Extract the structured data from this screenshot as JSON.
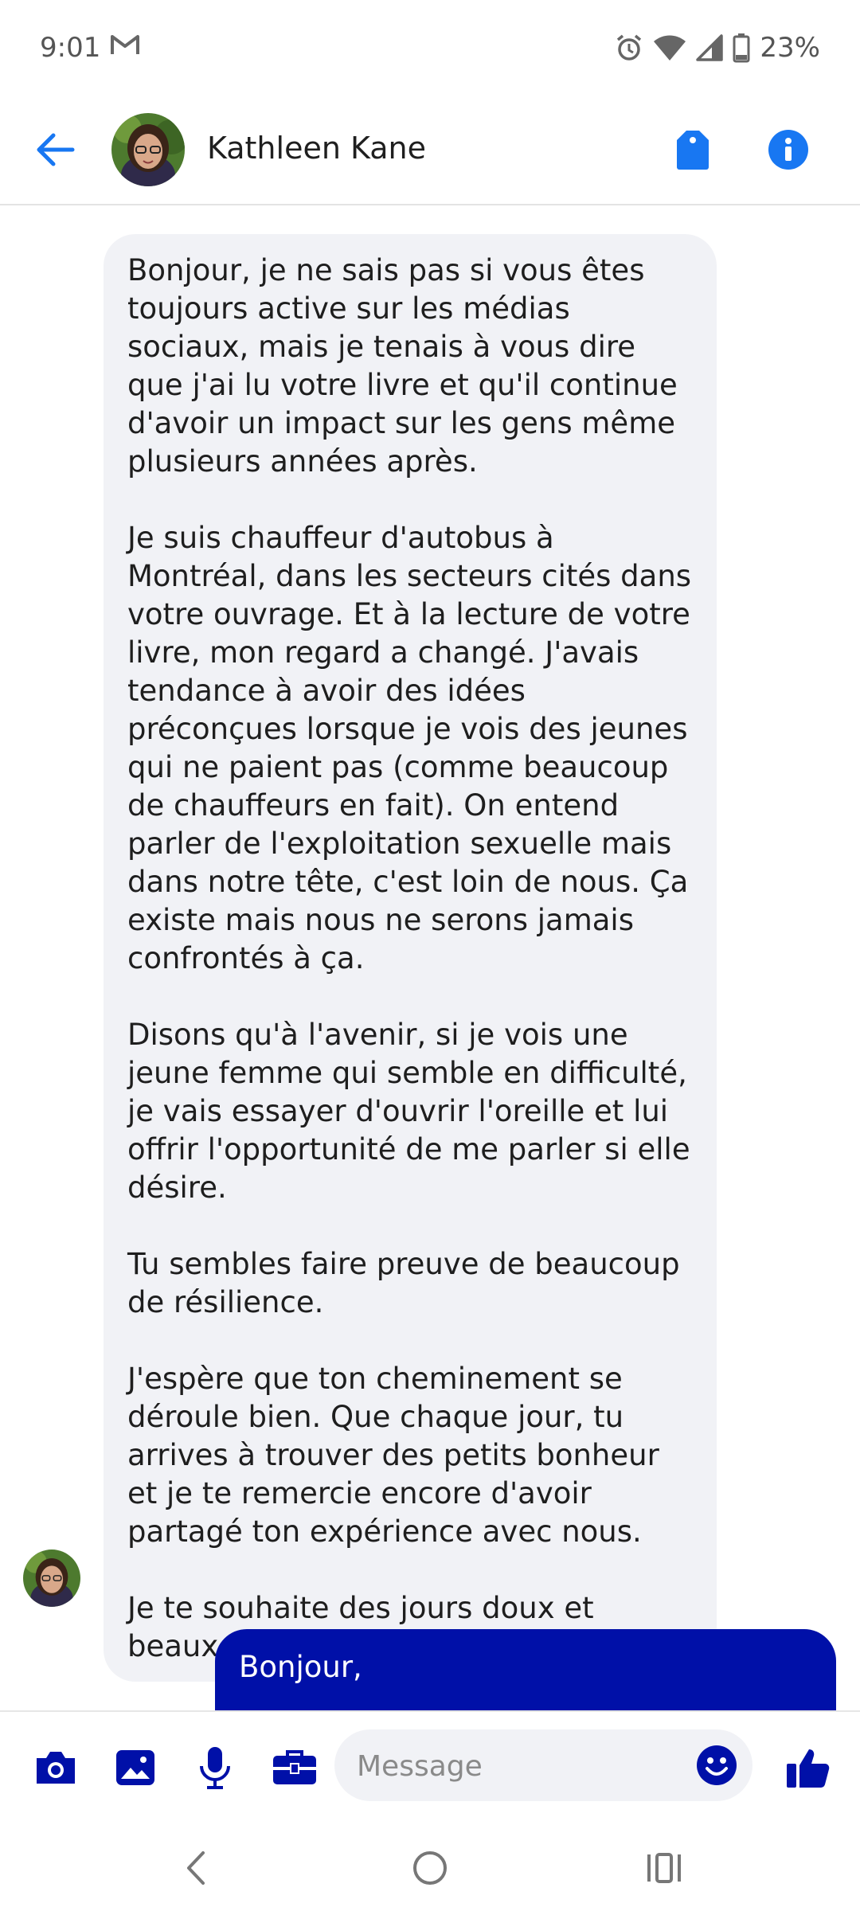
{
  "status_bar": {
    "time": "9:01",
    "battery": "23%",
    "icons": [
      "gmail-icon",
      "alarm-icon",
      "wifi-icon",
      "signal-icon",
      "battery-icon"
    ]
  },
  "header": {
    "contact_name": "Kathleen Kane",
    "icons": [
      "back-arrow-icon",
      "avatar",
      "tag-icon",
      "info-icon"
    ],
    "accent_color": "#1877f2"
  },
  "messages": [
    {
      "direction": "incoming",
      "paragraphs": [
        "Bonjour, je ne sais pas si vous êtes toujours active sur les médias sociaux, mais je tenais à vous dire que j'ai lu votre livre et qu'il continue d'avoir un impact sur les gens même plusieurs années après.",
        "Je suis chauffeur d'autobus à Montréal, dans les secteurs cités dans votre ouvrage. Et à la lecture de votre livre, mon regard a changé. J'avais tendance à avoir des idées préconçues lorsque je vois des jeunes qui ne paient pas (comme beaucoup de chauffeurs en fait). On entend parler de l'exploitation sexuelle mais dans notre tête, c'est loin de nous. Ça existe mais nous ne serons jamais confrontés à ça.",
        "Disons qu'à l'avenir, si je vois une jeune femme qui semble en difficulté, je vais essayer d'ouvrir l'oreille et lui offrir l'opportunité de me parler si elle désire.",
        "Tu sembles faire preuve de beaucoup de résilience.",
        "J'espère que ton cheminement se déroule bien. Que chaque jour, tu arrives à trouver des petits bonheur et je te remercie encore d'avoir partagé ton expérience avec nous.",
        "Je te souhaite des jours doux et beaux."
      ]
    },
    {
      "direction": "outgoing",
      "text": "Bonjour,"
    }
  ],
  "composer": {
    "placeholder": "Message",
    "icons": [
      "camera-icon",
      "gallery-icon",
      "microphone-icon",
      "briefcase-icon",
      "emoji-icon",
      "thumbs-up-icon"
    ],
    "icon_color": "#0010a8"
  },
  "nav_bar": {
    "icons": [
      "back-nav-icon",
      "home-nav-icon",
      "recents-nav-icon"
    ]
  }
}
